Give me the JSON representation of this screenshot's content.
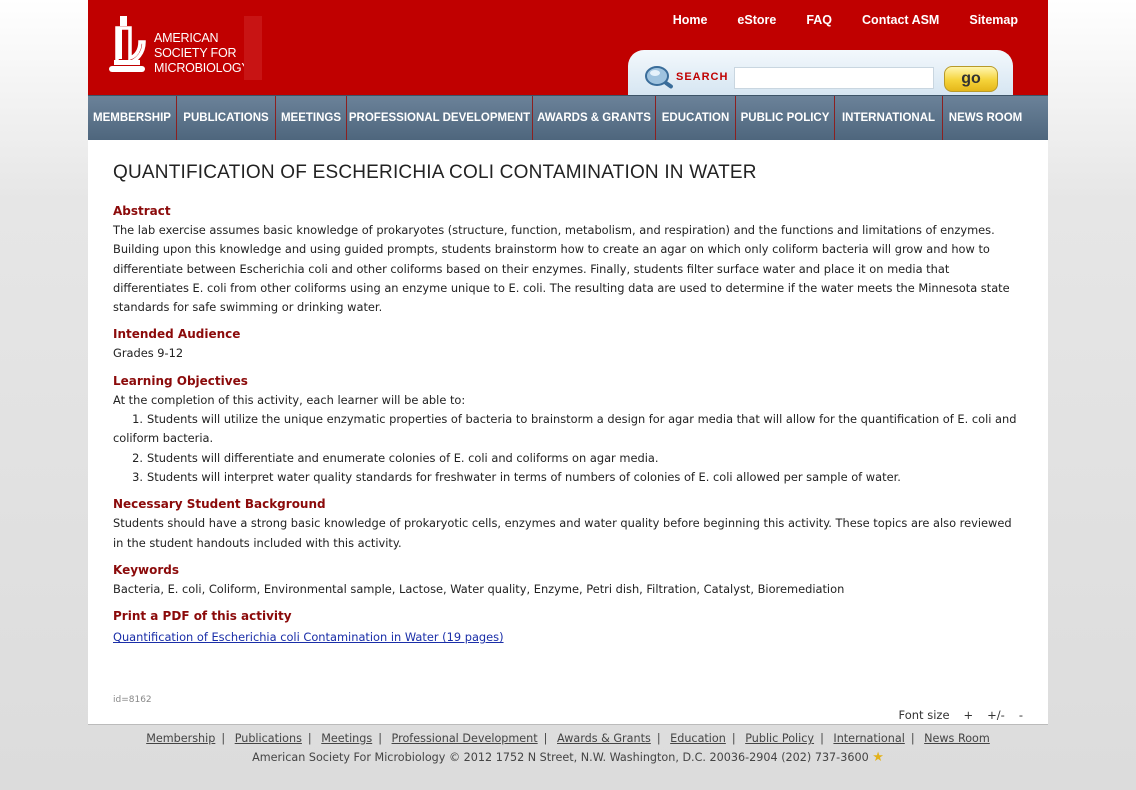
{
  "logo": {
    "line1": "AMERICAN",
    "line2": "SOCIETY FOR",
    "line3": "MICROBIOLOGY"
  },
  "toplinks": [
    "Home",
    "eStore",
    "FAQ",
    "Contact ASM",
    "Sitemap"
  ],
  "search": {
    "label": "SEARCH",
    "value": "",
    "placeholder": "",
    "button": "go"
  },
  "nav": [
    "MEMBERSHIP",
    "PUBLICATIONS",
    "MEETINGS",
    "PROFESSIONAL DEVELOPMENT",
    "AWARDS & GRANTS",
    "EDUCATION",
    "PUBLIC POLICY",
    "INTERNATIONAL",
    "NEWS ROOM"
  ],
  "article": {
    "title": "QUANTIFICATION OF ESCHERICHIA COLI CONTAMINATION IN WATER",
    "abstract_heading": "Abstract",
    "abstract": "The lab exercise assumes basic knowledge of prokaryotes (structure, function, metabolism, and respiration) and the functions and limitations of enzymes. Building upon this knowledge and using guided prompts, students brainstorm how to create an agar on which only coliform bacteria will grow and how to differentiate between Escherichia coli and other coliforms based on their enzymes. Finally, students filter surface water and place it on media that differentiates E. coli from other coliforms using an enzyme unique to E. coli. The resulting data are used to determine if the water meets the Minnesota state standards for safe swimming or drinking water.",
    "audience_heading": "Intended Audience",
    "audience": "Grades 9-12",
    "objectives_heading": "Learning Objectives",
    "objectives_intro": "At the completion of this activity, each learner will be able to:",
    "objectives": [
      "Students will utilize the unique enzymatic properties of bacteria to brainstorm a design for agar media that   will allow for the quantification of E. coli and coliform bacteria.",
      "Students will differentiate and enumerate colonies of E. coli and coliforms on agar media.",
      "Students will interpret water quality standards for freshwater in terms of numbers of colonies of E. coli allowed per sample of water."
    ],
    "background_heading": "Necessary Student Background",
    "background": "Students should have a strong basic knowledge of prokaryotic cells, enzymes and water quality before beginning this activity. These topics are also reviewed in the student handouts included with this activity.",
    "keywords_heading": "Keywords",
    "keywords": "Bacteria, E. coli, Coliform, Environmental sample, Lactose, Water quality, Enzyme, Petri dish, Filtration, Catalyst, Bioremediation",
    "pdf_heading": "Print a PDF of this activity",
    "pdf_link": "Quantification of Escherichia coli Contamination in Water (19 pages)",
    "doc_id": "id=8162"
  },
  "fontsize": {
    "label": "Font size",
    "increase": "+",
    "reset": "+/-",
    "decrease": "-"
  },
  "footer": {
    "links": [
      "Membership",
      "Publications",
      "Meetings",
      "Professional Development",
      "Awards & Grants",
      "Education",
      "Public Policy",
      "International",
      "News Room"
    ],
    "copyright": "American Society For Microbiology © 2012 1752 N Street, N.W. Washington, D.C. 20036-2904 (202) 737-3600"
  }
}
